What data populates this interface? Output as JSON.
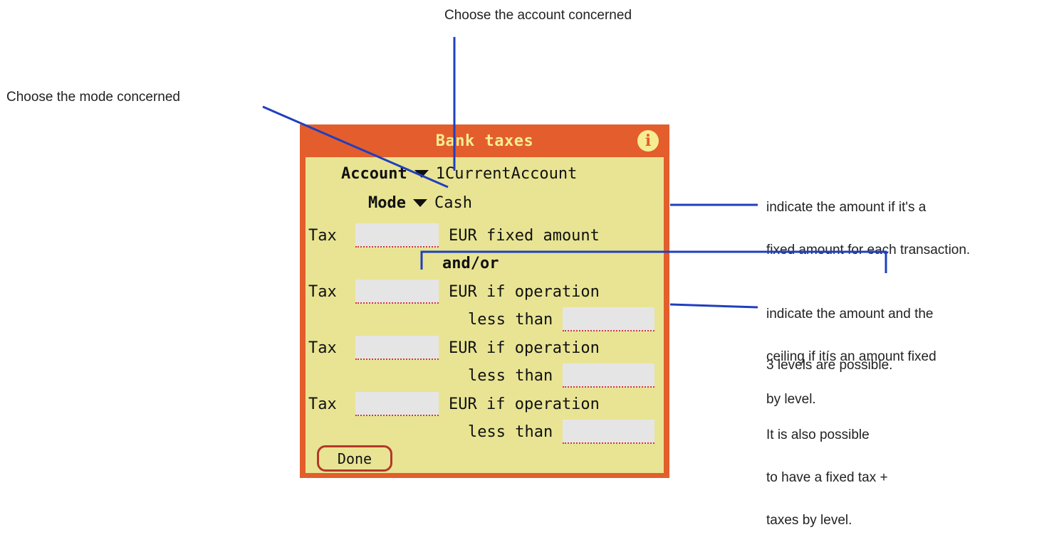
{
  "annotations": {
    "account": "Choose the account concerned",
    "mode": "Choose the mode concerned",
    "fixed": [
      "indicate the amount if it's a",
      "fixed amount for each transaction."
    ],
    "level": [
      "indicate the amount and the",
      "ceiling if itís an amount fixed",
      "by level."
    ],
    "levels_count": "3 levels are possible.",
    "combo": [
      "It is also possible",
      "to have a fixed tax +",
      "taxes by level."
    ]
  },
  "dialog": {
    "title": "Bank taxes",
    "info_icon": "i",
    "account_label": "Account",
    "account_value": "1CurrentAccount",
    "mode_label": "Mode",
    "mode_value": "Cash",
    "tax_label": "Tax",
    "fixed_text": "EUR  fixed amount",
    "and_or": "and/or",
    "level_text": "EUR  if operation",
    "less_than": "less than",
    "done": "Done",
    "fields": {
      "fixed_tax": "",
      "level1_tax": "",
      "level1_ceiling": "",
      "level2_tax": "",
      "level2_ceiling": "",
      "level3_tax": "",
      "level3_ceiling": ""
    }
  },
  "colors": {
    "frame": "#e35e2c",
    "panel": "#e8e493",
    "title_text": "#f6ed92",
    "callout_line": "#1f3fbf",
    "field": "#e6e5e6"
  }
}
